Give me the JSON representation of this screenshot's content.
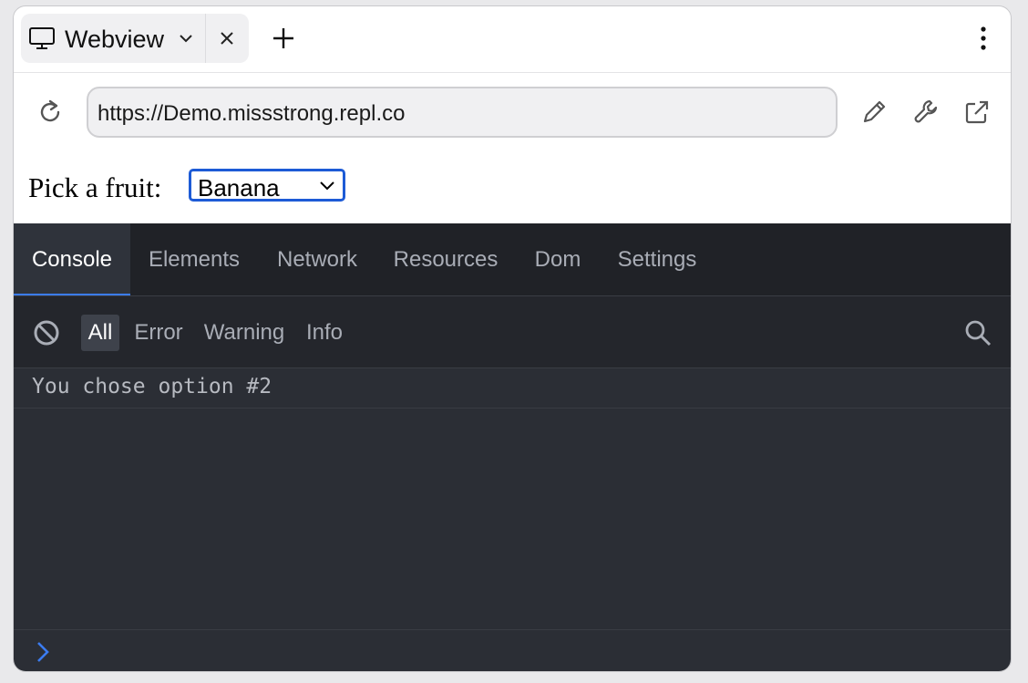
{
  "tab": {
    "title": "Webview",
    "icon": "monitor-icon"
  },
  "address_bar": {
    "url": "https://Demo.missstrong.repl.co"
  },
  "page": {
    "label": "Pick a fruit:",
    "select_value": "Banana"
  },
  "devtools": {
    "tabs": [
      "Console",
      "Elements",
      "Network",
      "Resources",
      "Dom",
      "Settings"
    ],
    "active_tab": "Console",
    "filters": [
      "All",
      "Error",
      "Warning",
      "Info"
    ],
    "active_filter": "All",
    "logs": [
      "You chose option #2"
    ]
  },
  "colors": {
    "accent": "#3b7cf0",
    "devtools_bg": "#2b2e35",
    "select_border": "#1d5bd6"
  }
}
